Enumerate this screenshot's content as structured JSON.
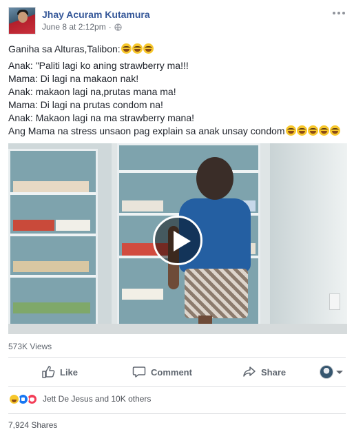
{
  "post": {
    "author": "Jhay Acuram Kutamura",
    "timestamp": "June 8 at 2:12pm",
    "privacy_icon": "globe-icon",
    "text_lines": [
      "Ganiha sa Alturas,Talibon:",
      "Anak: \"Paliti lagi ko aning strawberry ma!!!",
      "Mama: Di lagi na makaon nak!",
      "Anak: makaon lagi na,prutas mana ma!",
      "Mama: Di lagi na prutas condom na!",
      "Anak: Makaon lagi na ma strawberry mana!",
      "Ang Mama na stress unsaon pag explain sa anak unsay condom"
    ],
    "emoji_name": "tears-of-joy-emoji"
  },
  "video": {
    "views": "573K Views",
    "play_icon": "play-icon"
  },
  "actions": {
    "like": "Like",
    "comment": "Comment",
    "share": "Share"
  },
  "reactions": {
    "icons": [
      "haha",
      "like",
      "love"
    ],
    "summary": "Jett De Jesus and 10K others"
  },
  "shares": "7,924 Shares",
  "colors": {
    "author_link": "#365899",
    "meta_text": "#616770",
    "like_blue": "#1877f2",
    "love_red": "#f33e58",
    "haha_yellow": "#f7c72c"
  }
}
